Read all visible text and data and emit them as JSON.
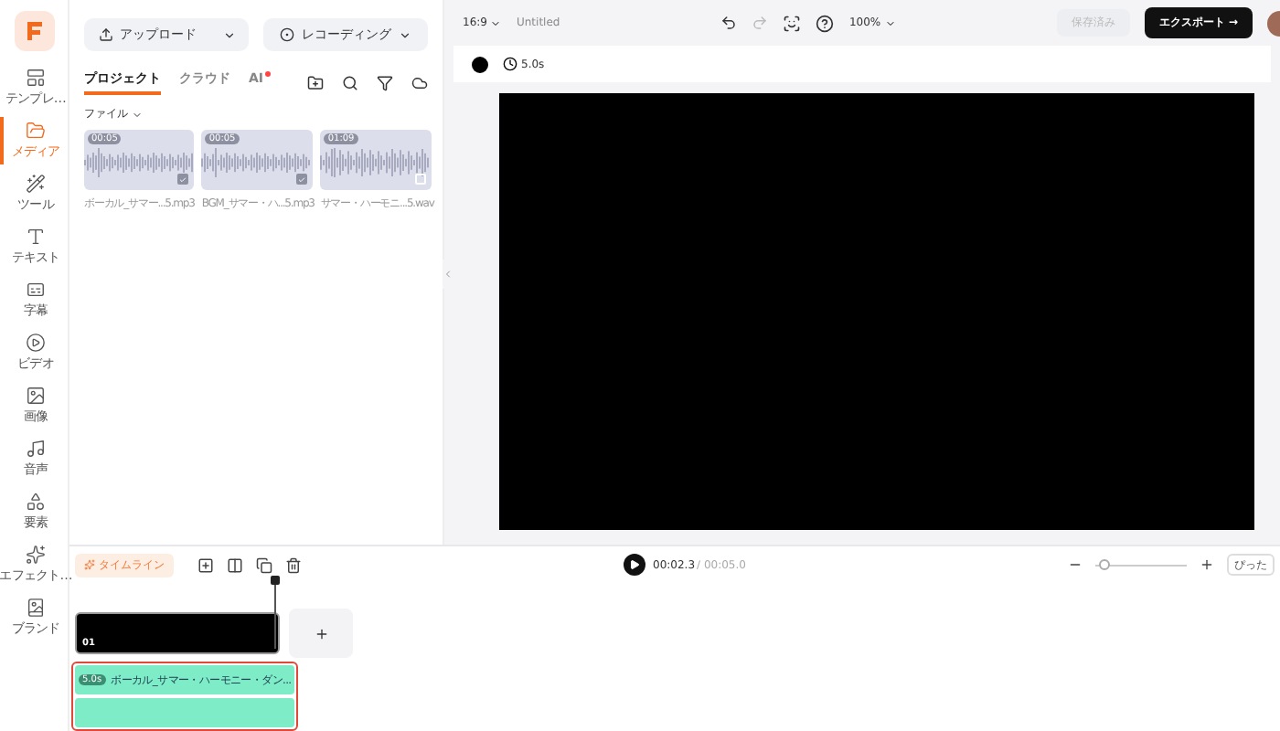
{
  "sidebar": {
    "items": [
      {
        "label": "テンプレ…",
        "selected": false
      },
      {
        "label": "メディア",
        "selected": true
      },
      {
        "label": "ツール",
        "selected": false
      },
      {
        "label": "テキスト",
        "selected": false
      },
      {
        "label": "字幕",
        "selected": false
      },
      {
        "label": "ビデオ",
        "selected": false
      },
      {
        "label": "画像",
        "selected": false
      },
      {
        "label": "音声",
        "selected": false
      },
      {
        "label": "要素",
        "selected": false
      },
      {
        "label": "エフェクト…",
        "selected": false
      },
      {
        "label": "ブランド",
        "selected": false
      }
    ]
  },
  "media_panel": {
    "upload_button": "アップロード",
    "record_button": "レコーディング",
    "tabs": [
      {
        "label": "プロジェクト",
        "selected": true,
        "badge": false
      },
      {
        "label": "クラウド",
        "selected": false,
        "badge": false
      },
      {
        "label": "AI",
        "selected": false,
        "badge": true
      }
    ],
    "filter": "ファイル",
    "files": [
      {
        "duration": "00:05",
        "name": "ボーカル_サマー...5.mp3",
        "checked": true
      },
      {
        "duration": "00:05",
        "name": "BGM_サマー・ハ...5.mp3",
        "checked": true
      },
      {
        "duration": "01:09",
        "name": "サマー・ハーモニ...5.wav",
        "checked": false
      }
    ]
  },
  "top_bar": {
    "aspect": "16:9",
    "title": "Untitled",
    "zoom": "100%",
    "saved_button": "保存済み",
    "export_button": "エクスポート →"
  },
  "canvas_bar": {
    "duration": "5.0s"
  },
  "timeline": {
    "timeline_button": "タイムライン",
    "current_time": "00:02.3",
    "total_time": "/ 00:05.0",
    "fit_button": "ぴった",
    "zoom": {
      "level": 0.1
    },
    "video_clip": {
      "label": "01"
    },
    "audio_clip": {
      "badge": "5.0s",
      "name": "ボーカル_サマー・ハーモニー・ダン...",
      "selected": true
    }
  }
}
